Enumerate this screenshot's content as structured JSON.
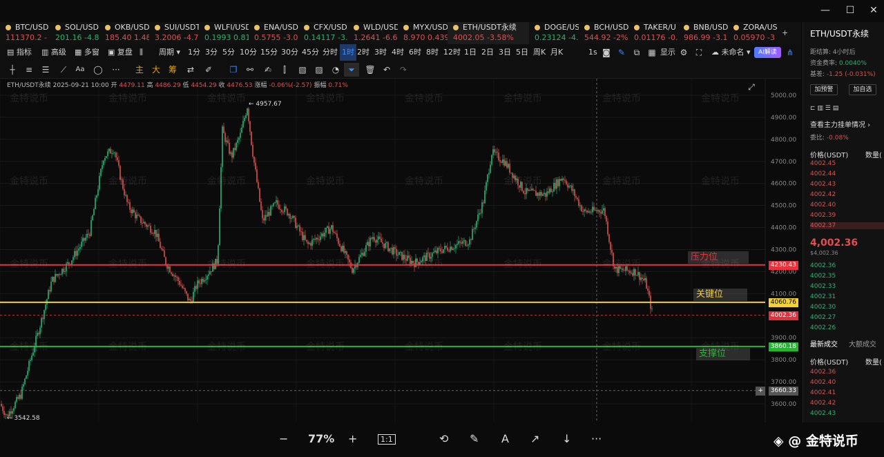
{
  "window": {
    "minimize": "—",
    "maximize": "☐",
    "close": "✕"
  },
  "tickers": [
    {
      "name": "BTC/USD",
      "price": "111370.2",
      "change": "-",
      "color": "#e05050"
    },
    {
      "name": "SOL/USD",
      "price": "201.16",
      "change": "-4.8",
      "color": "#29b36a"
    },
    {
      "name": "OKB/USD",
      "price": "185.40",
      "change": "1.48",
      "color": "#e05050"
    },
    {
      "name": "SUI/USDT",
      "price": "3.2006",
      "change": "-4.7",
      "color": "#e05050"
    },
    {
      "name": "WLFI/USD",
      "price": "0.1993",
      "change": "0.81",
      "color": "#29b36a"
    },
    {
      "name": "ENA/USD",
      "price": "0.5755",
      "change": "-3.0",
      "color": "#e05050"
    },
    {
      "name": "CFX/USD",
      "price": "0.14117",
      "change": "-3.",
      "color": "#29b36a"
    },
    {
      "name": "WLD/USD",
      "price": "1.2641",
      "change": "-6.6",
      "color": "#e05050"
    },
    {
      "name": "MYX/USD",
      "price": "8.970",
      "change": "0.439",
      "color": "#e05050"
    },
    {
      "name": "ETH/USDT永续",
      "price": "4002.05",
      "change": "-3.58%",
      "color": "#e05050"
    },
    {
      "name": "DOGE/US",
      "price": "0.23124",
      "change": "-4.",
      "color": "#29b36a"
    },
    {
      "name": "BCH/USD",
      "price": "544.92",
      "change": "-2%",
      "color": "#e05050"
    },
    {
      "name": "TAKER/U",
      "price": "0.01176",
      "change": "-0.",
      "color": "#e05050"
    },
    {
      "name": "BNB/USD",
      "price": "986.99",
      "change": "-3.1",
      "color": "#e05050"
    },
    {
      "name": "ZORA/US",
      "price": "0.05970",
      "change": "-3",
      "color": "#e05050"
    }
  ],
  "toolbar1": {
    "indicator": "指标",
    "advanced": "高级",
    "multi": "多窗",
    "replay": "复盘",
    "period": "周期",
    "periods": [
      "1分",
      "3分",
      "5分",
      "10分",
      "15分",
      "30分",
      "45分",
      "分时",
      "1时",
      "2时",
      "3时",
      "4时",
      "6时",
      "8时",
      "12时",
      "1日",
      "2日",
      "3日",
      "5日",
      "周K",
      "月K"
    ],
    "selected_period": "1时",
    "speed": "1s",
    "display": "显示",
    "unnamed": "未命名",
    "ai": "AI解读"
  },
  "toolbar2": {
    "main": "主",
    "big": "大",
    "chip": "筹"
  },
  "legend": {
    "symbol": "ETH/USDT永续",
    "datetime": "2025-09-21 10:00",
    "open_label": "开",
    "open": "4479.11",
    "high_label": "高",
    "high": "4486.29",
    "low_label": "低",
    "low": "4454.29",
    "close_label": "收",
    "close": "4476.53",
    "change_label": "涨幅",
    "change": "-0.06%(-2.57)",
    "amp_label": "振幅",
    "amp": "0.71%"
  },
  "chart_data": {
    "type": "candlestick",
    "y_ticks": [
      5000,
      4900,
      4800,
      4700,
      4600,
      4500,
      4400,
      4300,
      4200,
      4100,
      3900,
      3800,
      3700,
      3600
    ],
    "y_tick_labels": [
      "5000.00",
      "4900.00",
      "4800.00",
      "4700.00",
      "4600.00",
      "4500.00",
      "4400.00",
      "4300.00",
      "4200.00",
      "4100.00",
      "3900.00",
      "3800.00",
      "3700.00",
      "3600.00"
    ],
    "ylim": [
      3500,
      5010
    ],
    "levels": [
      {
        "name": "压力位",
        "value": 4230.43,
        "label": "4230.43",
        "color": "#e8323c"
      },
      {
        "name": "关键位",
        "value": 4060.76,
        "label": "4060.76",
        "color": "#f2d03a"
      },
      {
        "name": "支撑位",
        "value": 3860.18,
        "label": "3860.18",
        "color": "#29b336"
      }
    ],
    "current_price": {
      "value": 4002.36,
      "label": "4002.36"
    },
    "crosshair_price": {
      "value": 3660.33,
      "label": "3660.33"
    },
    "high_annotation": "← 4957.67",
    "low_annotation": "← 3542.58",
    "high_value": 4957.67,
    "low_value": 3542.58,
    "path_keypoints": [
      [
        0,
        3600
      ],
      [
        10,
        3545
      ],
      [
        30,
        3640
      ],
      [
        60,
        3980
      ],
      [
        75,
        4160
      ],
      [
        100,
        4240
      ],
      [
        130,
        4380
      ],
      [
        150,
        4720
      ],
      [
        165,
        4760
      ],
      [
        175,
        4620
      ],
      [
        185,
        4500
      ],
      [
        200,
        4440
      ],
      [
        225,
        4380
      ],
      [
        240,
        4240
      ],
      [
        260,
        4150
      ],
      [
        275,
        4060
      ],
      [
        285,
        4140
      ],
      [
        300,
        4190
      ],
      [
        315,
        4250
      ],
      [
        322,
        4840
      ],
      [
        335,
        4720
      ],
      [
        348,
        4820
      ],
      [
        358,
        4950
      ],
      [
        365,
        4760
      ],
      [
        380,
        4430
      ],
      [
        400,
        4510
      ],
      [
        420,
        4460
      ],
      [
        445,
        4320
      ],
      [
        480,
        4400
      ],
      [
        510,
        4210
      ],
      [
        540,
        4360
      ],
      [
        575,
        4280
      ],
      [
        600,
        4240
      ],
      [
        640,
        4300
      ],
      [
        680,
        4340
      ],
      [
        700,
        4520
      ],
      [
        712,
        4740
      ],
      [
        730,
        4700
      ],
      [
        760,
        4560
      ],
      [
        790,
        4550
      ],
      [
        815,
        4630
      ],
      [
        830,
        4560
      ],
      [
        845,
        4470
      ],
      [
        875,
        4480
      ],
      [
        884,
        4310
      ],
      [
        890,
        4210
      ],
      [
        920,
        4200
      ],
      [
        935,
        4150
      ],
      [
        945,
        4002
      ]
    ]
  },
  "price_axis": {
    "labels_color": "#888"
  },
  "watermark": "金特说币",
  "bottom": {
    "zoom": "77%",
    "zoom_out": "−",
    "zoom_in": "+",
    "fit": "1:1",
    "rotate": "⟲",
    "edit": "✎",
    "text": "A",
    "share": "↗",
    "download": "↓",
    "more": "···"
  },
  "brand": "@ 金特说币",
  "right_panel": {
    "title": "ETH/USDT永续",
    "settle_label": "距结算:",
    "settle_value": "4小时后",
    "funding_label": "资金费率:",
    "funding_value": "0.0040%",
    "basis_label": "基差:",
    "basis_value": "-1.25 (-0.031%)",
    "btn_alert": "加预警",
    "btn_watch": "加自选",
    "orders_link": "查看主力挂单情况",
    "ratio_label": "委比:",
    "ratio_value": "-0.08%",
    "price_col": "价格(USDT)",
    "qty_col": "数量(",
    "asks": [
      "4002.45",
      "4002.44",
      "4002.43",
      "4002.42",
      "4002.40",
      "4002.39",
      "4002.37"
    ],
    "last_price": "4,002.36",
    "last_sub": "$4,002.36",
    "bids": [
      "4002.36",
      "4002.35",
      "4002.33",
      "4002.31",
      "4002.30",
      "4002.27",
      "4002.26"
    ],
    "tab_recent": "最新成交",
    "tab_large": "大额成交",
    "trades_price_col": "价格(USDT)",
    "trades_qty_col": "数量(",
    "trades": [
      "4002.36",
      "4002.40",
      "4002.41",
      "4002.42",
      "4002.43"
    ]
  }
}
